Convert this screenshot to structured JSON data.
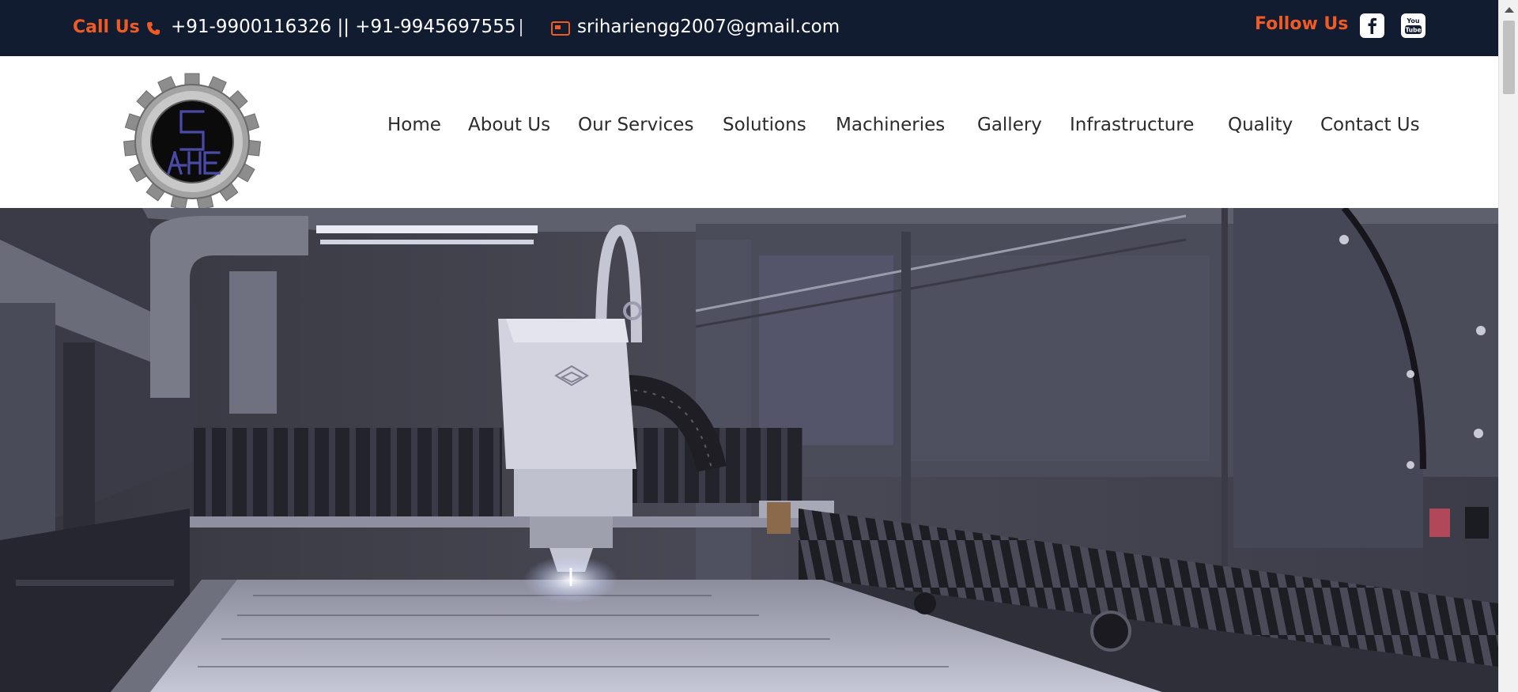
{
  "topbar": {
    "call_label": "Call Us",
    "phones": "+91-9900116326 || +91-9945697555",
    "email": "sriharie​ngg2007@gmail.com",
    "follow_label": "Follow Us",
    "icons": [
      "phone-icon",
      "mail-icon",
      "facebook-icon",
      "youtube-icon"
    ]
  },
  "brand": {
    "logo_letters": "SHE"
  },
  "nav": {
    "items": [
      "Home",
      "About Us",
      "Our Services",
      "Solutions",
      "Machineries",
      "Gallery",
      "Infrastructure",
      "Quality",
      "Contact Us"
    ]
  },
  "colors": {
    "topbar_bg": "#121c30",
    "accent": "#f05a24",
    "nav_text": "#2b2b2b",
    "logo_letters": "#4a4aa8"
  }
}
